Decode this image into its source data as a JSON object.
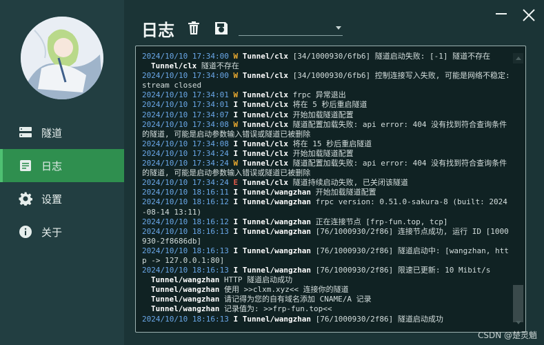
{
  "sidebar": {
    "items": [
      {
        "label": "隧道",
        "icon": "server-icon",
        "active": false
      },
      {
        "label": "日志",
        "icon": "document-icon",
        "active": true
      },
      {
        "label": "设置",
        "icon": "gear-icon",
        "active": false
      },
      {
        "label": "关于",
        "icon": "info-icon",
        "active": false
      }
    ]
  },
  "header": {
    "title": "日志",
    "select_value": ""
  },
  "log": {
    "lines": [
      {
        "ts": "2024/10/10 17:34:00",
        "lvl": "W",
        "tunnel": "Tunnel/clx",
        "msg": " [34/1000930/6fb6] 隧道启动失败: [-1] 隧道不存在"
      },
      {
        "cont": true,
        "tunnel": "Tunnel/clx",
        "msg": " 隧道不存在"
      },
      {
        "ts": "2024/10/10 17:34:00",
        "lvl": "W",
        "tunnel": "Tunnel/clx",
        "msg": " [34/1000930/6fb6] 控制连接写入失败, 可能是网络不稳定: stream closed"
      },
      {
        "ts": "2024/10/10 17:34:01",
        "lvl": "W",
        "tunnel": "Tunnel/clx",
        "msg": " frpc 异常退出"
      },
      {
        "ts": "2024/10/10 17:34:01",
        "lvl": "I",
        "tunnel": "Tunnel/clx",
        "msg": " 将在 5 秒后重启隧道"
      },
      {
        "ts": "2024/10/10 17:34:07",
        "lvl": "I",
        "tunnel": "Tunnel/clx",
        "msg": " 开始加载隧道配置"
      },
      {
        "ts": "2024/10/10 17:34:08",
        "lvl": "W",
        "tunnel": "Tunnel/clx",
        "msg": " 隧道配置加载失败: api error: 404 没有找到符合查询条件的隧道, 可能是启动参数输入错误或隧道已被删除"
      },
      {
        "ts": "2024/10/10 17:34:08",
        "lvl": "I",
        "tunnel": "Tunnel/clx",
        "msg": " 将在 15 秒后重启隧道"
      },
      {
        "ts": "2024/10/10 17:34:24",
        "lvl": "I",
        "tunnel": "Tunnel/clx",
        "msg": " 开始加载隧道配置"
      },
      {
        "ts": "2024/10/10 17:34:24",
        "lvl": "W",
        "tunnel": "Tunnel/clx",
        "msg": " 隧道配置加载失败: api error: 404 没有找到符合查询条件的隧道, 可能是启动参数输入错误或隧道已被删除"
      },
      {
        "ts": "2024/10/10 17:34:24",
        "lvl": "E",
        "tunnel": "Tunnel/clx",
        "msg": " 隧道持续启动失败, 已关闭该隧道"
      },
      {
        "ts": "2024/10/10 18:16:11",
        "lvl": "I",
        "tunnel": "Tunnel/wangzhan",
        "msg": " 开始加载隧道配置"
      },
      {
        "ts": "2024/10/10 18:16:12",
        "lvl": "I",
        "tunnel": "Tunnel/wangzhan",
        "msg": " frpc version: 0.51.0-sakura-8 (built: 2024-08-14 13:11)"
      },
      {
        "ts": "2024/10/10 18:16:12",
        "lvl": "I",
        "tunnel": "Tunnel/wangzhan",
        "msg": " 正在连接节点 [frp-fun.top, tcp]"
      },
      {
        "ts": "2024/10/10 18:16:13",
        "lvl": "I",
        "tunnel": "Tunnel/wangzhan",
        "msg": " [76/1000930/2f86] 连接节点成功, 运行 ID [1000930-2f8686db]"
      },
      {
        "ts": "2024/10/10 18:16:13",
        "lvl": "I",
        "tunnel": "Tunnel/wangzhan",
        "msg": " [76/1000930/2f86] 隧道启动中: [wangzhan, http -> 127.0.0.1:80]"
      },
      {
        "ts": "2024/10/10 18:16:13",
        "lvl": "I",
        "tunnel": "Tunnel/wangzhan",
        "msg": " [76/1000930/2f86] 限速已更新: 10 Mibit/s"
      },
      {
        "cont": true,
        "tunnel": "Tunnel/wangzhan",
        "msg": " HTTP 隧道启动成功"
      },
      {
        "cont": true,
        "tunnel": "Tunnel/wangzhan",
        "msg": " 使用 >>clxm.xyz<< 连接你的隧道"
      },
      {
        "cont": true,
        "tunnel": "Tunnel/wangzhan",
        "msg": " 请记得为您的自有域名添加 CNAME/A 记录"
      },
      {
        "cont": true,
        "tunnel": "Tunnel/wangzhan",
        "msg": " 记录值为: >>frp-fun.top<<"
      },
      {
        "ts": "2024/10/10 18:16:13",
        "lvl": "I",
        "tunnel": "Tunnel/wangzhan",
        "msg": " [76/1000930/2f86] 隧道启动成功"
      }
    ]
  },
  "watermark": "CSDN @楚灵魈",
  "colors": {
    "accent": "#2f8f4f",
    "timestamp": "#6aa7e8",
    "warn": "#e8a930",
    "error": "#e15a4a"
  }
}
